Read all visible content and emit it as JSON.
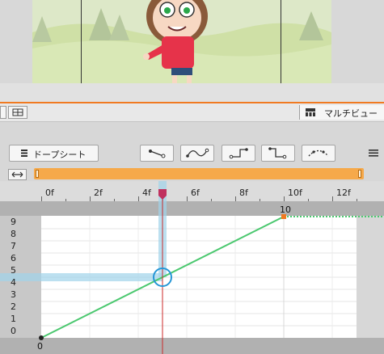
{
  "panel": {
    "multiview_label": "マルチビュー"
  },
  "toolbar": {
    "dopesheet_label": "ドープシート"
  },
  "ruler": {
    "labels": [
      "0f",
      "2f",
      "4f",
      "6f",
      "8f",
      "10f",
      "12f"
    ]
  },
  "graph": {
    "y_labels": [
      "9",
      "8",
      "7",
      "6",
      "5",
      "4",
      "3",
      "2",
      "1",
      "0"
    ],
    "start_key_label": "0",
    "end_key_label": "10",
    "current_frame": 5,
    "current_value": 5
  },
  "colors": {
    "accent": "#f07a21",
    "range": "#f6a94a",
    "curve": "#4bc86f",
    "playhead": "#c0315f",
    "highlight": "#9fd3ea"
  }
}
